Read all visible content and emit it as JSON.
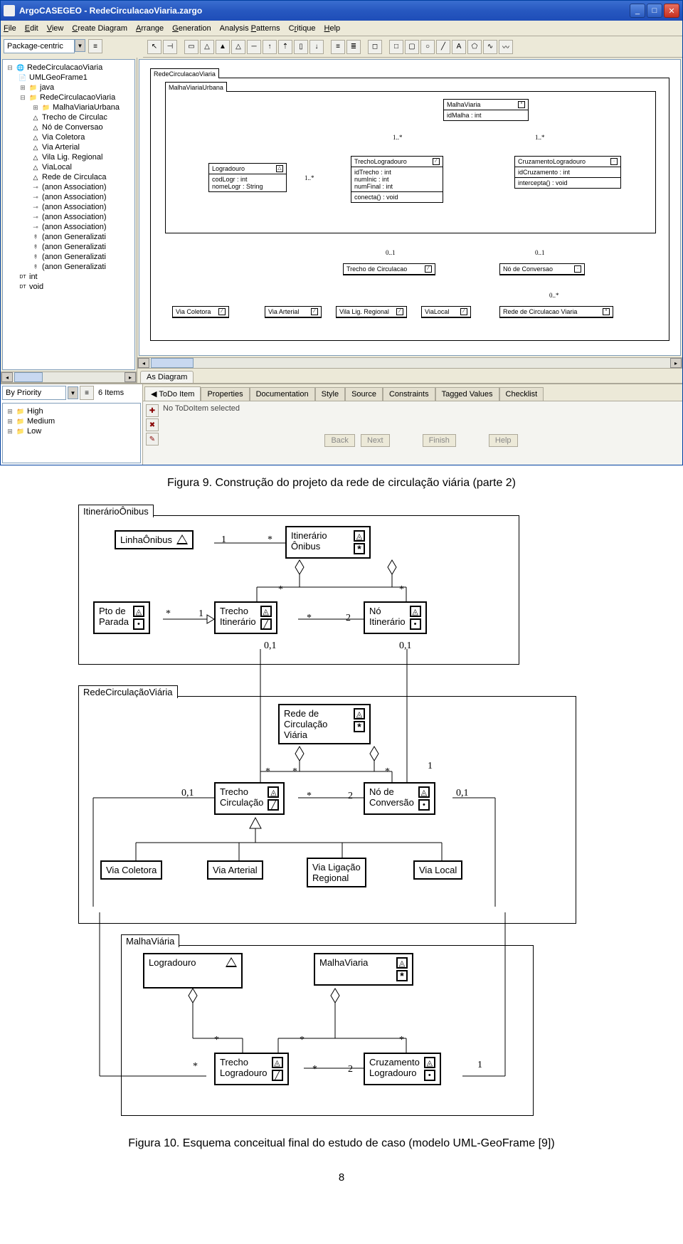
{
  "titlebar": {
    "text": "ArgoCASEGEO - RedeCirculacaoViaria.zargo"
  },
  "menu": {
    "file": "File",
    "edit": "Edit",
    "view": "View",
    "create": "Create Diagram",
    "arrange": "Arrange",
    "generation": "Generation",
    "patterns": "Analysis Patterns",
    "critique": "Critique",
    "help": "Help"
  },
  "perspective": {
    "value": "Package-centric"
  },
  "tree": {
    "root": "RedeCirculacaoViaria",
    "items": [
      "UMLGeoFrame1",
      "java",
      "RedeCirculacaoViaria",
      "MalhaViariaUrbana",
      "Trecho de Circulac",
      "Nó de Conversao",
      "Via Coletora",
      "Via Arterial",
      "Vila Lig. Regional",
      "ViaLocal",
      "Rede de Circulaca",
      "(anon Association)",
      "(anon Association)",
      "(anon Association)",
      "(anon Association)",
      "(anon Association)",
      "(anon Generalizati",
      "(anon Generalizati",
      "(anon Generalizati",
      "(anon Generalizati",
      "int",
      "void"
    ]
  },
  "diagram": {
    "pkg1": "RedeCirculacaoViaria",
    "pkg2": "MalhaViariaUrbana",
    "malhaviaria": {
      "name": "MalhaViaria",
      "attr": "idMalha : int"
    },
    "logradouro": {
      "name": "Logradouro",
      "a1": "codLogr : int",
      "a2": "nomeLogr : String"
    },
    "trecholog": {
      "name": "TrechoLogradouro",
      "a1": "idTrecho : int",
      "a2": "numInic : int",
      "a3": "numFinal : int",
      "op": "conecta() : void"
    },
    "cruz": {
      "name": "CruzamentoLogradouro",
      "a1": "idCruzamento : int",
      "op": "intercepta() : void"
    },
    "trechocirc": "Trecho de Circulacao",
    "noconv": "Nó de Conversao",
    "viacoletora": "Via Coletora",
    "viaarterial": "Via Arterial",
    "vilalig": "Vila Lig. Regional",
    "vialocal": "ViaLocal",
    "redecirc": "Rede de Circulacao Viaria",
    "m1": "1..*",
    "m2": "1..*",
    "m3": "1..*",
    "m01": "0..1",
    "m0n": "0..*"
  },
  "astab": "As Diagram",
  "priority": {
    "label": "By Priority",
    "count": "6 Items",
    "high": "High",
    "medium": "Medium",
    "low": "Low"
  },
  "detail": {
    "tabs": {
      "todo": "ToDo Item",
      "props": "Properties",
      "doc": "Documentation",
      "style": "Style",
      "source": "Source",
      "constraints": "Constraints",
      "tagged": "Tagged Values",
      "checklist": "Checklist"
    },
    "msg": "No ToDoItem selected",
    "btns": {
      "back": "Back",
      "next": "Next",
      "finish": "Finish",
      "help": "Help"
    }
  },
  "fig9": "Figura 9. Construção do projeto da rede de circulação viária (parte 2)",
  "fig10": "Figura 10. Esquema conceitual final do estudo de caso (modelo UML-GeoFrame [9])",
  "pagenum": "8",
  "uml": {
    "pkg_itin": "ItinerárioÔnibus",
    "pkg_rede": "RedeCirculaçãoViária",
    "pkg_malha": "MalhaViária",
    "linha": "LinhaÔnibus",
    "itin": "Itinerário\nÔnibus",
    "pto": "Pto de\nParada",
    "trechoitin": "Trecho\nItinerário",
    "noitin": "Nó\nItinerário",
    "redecirc": "Rede de\nCirculação\nViária",
    "trechocirc": "Trecho\nCirculação",
    "noconv": "Nó de\nConversão",
    "viacoletora": "Via Coletora",
    "viaarterial": "Via Arterial",
    "vialig": "Via Ligação\nRegional",
    "vialocal": "Via Local",
    "logradouro": "Logradouro",
    "malhaviaria": "MalhaViaria",
    "trecholog": "Trecho\nLogradouro",
    "cruzlog": "Cruzamento\nLogradouro",
    "m1": "1",
    "mstar": "*",
    "m2": "2",
    "m01": "0,1"
  }
}
